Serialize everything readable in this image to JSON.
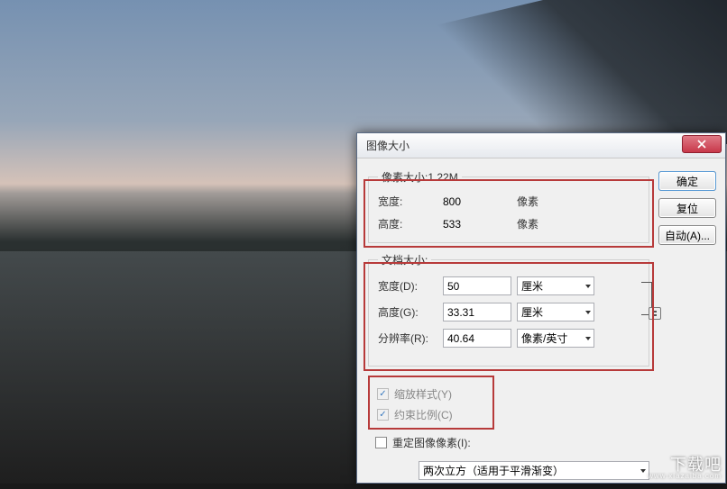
{
  "dialog": {
    "title": "图像大小"
  },
  "pixel_size": {
    "legend": "像素大小:1.22M",
    "width_label": "宽度:",
    "width_value": "800",
    "width_unit": "像素",
    "height_label": "高度:",
    "height_value": "533",
    "height_unit": "像素"
  },
  "doc_size": {
    "legend": "文档大小:",
    "width_label": "宽度(D):",
    "width_value": "50",
    "width_unit": "厘米",
    "height_label": "高度(G):",
    "height_value": "33.31",
    "height_unit": "厘米",
    "res_label": "分辨率(R):",
    "res_value": "40.64",
    "res_unit": "像素/英寸"
  },
  "options": {
    "scale_styles": "缩放样式(Y)",
    "constrain": "约束比例(C)",
    "resample": "重定图像像素(I):",
    "resample_method": "两次立方（适用于平滑渐变）"
  },
  "buttons": {
    "ok": "确定",
    "reset": "复位",
    "auto": "自动(A)..."
  },
  "watermark": {
    "main": "下载吧",
    "sub": "www.xiazaiba.com"
  }
}
